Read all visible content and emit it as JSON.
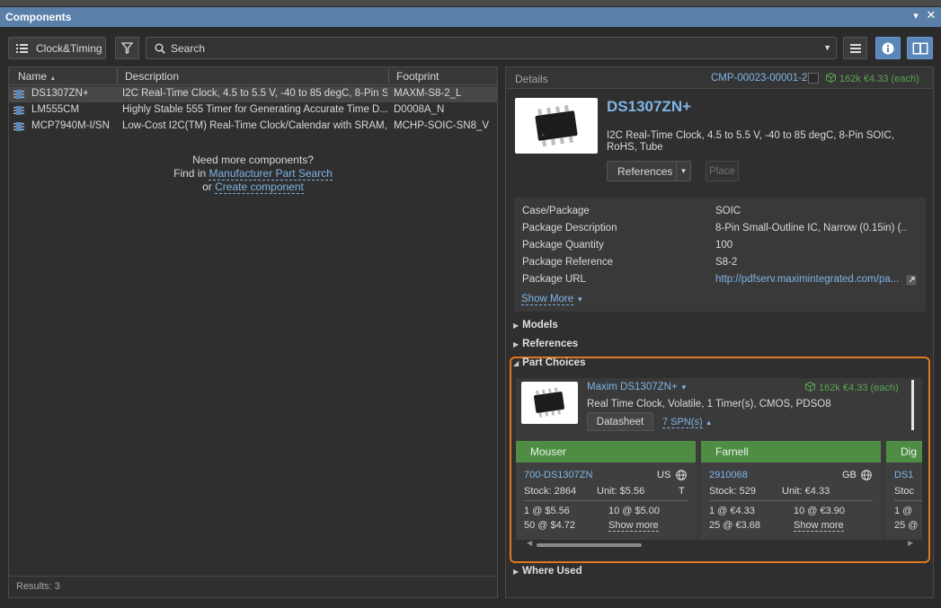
{
  "window": {
    "title": "Components",
    "menu_glyph": "▾",
    "close_glyph": "✕"
  },
  "toolbar": {
    "category_label": "Clock&Timing",
    "search_placeholder": "Search"
  },
  "table": {
    "columns": [
      "Name",
      "Description",
      "Footprint"
    ],
    "rows": [
      {
        "name": "DS1307ZN+",
        "description": "I2C Real-Time Clock, 4.5 to 5.5 V, -40 to 85 degC, 8-Pin S...",
        "footprint": "MAXM-S8-2_L"
      },
      {
        "name": "LM555CM",
        "description": "Highly Stable 555 Timer for Generating Accurate Time D...",
        "footprint": "D0008A_N"
      },
      {
        "name": "MCP7940M-I/SN",
        "description": "Low-Cost I2C(TM) Real-Time Clock/Calendar with SRAM,...",
        "footprint": "MCHP-SOIC-SN8_V"
      }
    ],
    "selected_index": 0,
    "sort_indicator": "▲"
  },
  "empty_message": {
    "line1": "Need more components?",
    "line2_prefix": "Find in",
    "mps_link": "Manufacturer Part Search",
    "line3_prefix": "or",
    "create_link": "Create component"
  },
  "results": "Results: 3",
  "details": {
    "header": "Details",
    "component_id": "CMP-00023-00001-2",
    "stock_summary": "162k  €4.33 (each)",
    "name": "DS1307ZN+",
    "description": "I2C Real-Time Clock, 4.5 to 5.5 V, -40 to 85 degC, 8-Pin SOIC, RoHS, Tube",
    "references_button": "References",
    "place_button": "Place",
    "properties": [
      {
        "key": "Case/Package",
        "value": "SOIC"
      },
      {
        "key": "Package Description",
        "value": "8-Pin Small-Outline IC, Narrow (0.15in) (..."
      },
      {
        "key": "Package Quantity",
        "value": "100"
      },
      {
        "key": "Package Reference",
        "value": "S8-2"
      },
      {
        "key": "Package URL",
        "value": "http://pdfserv.maximintegrated.com/pa..."
      }
    ],
    "show_more": "Show More",
    "sections": {
      "models": "Models",
      "references": "References",
      "part_choices": "Part Choices",
      "where_used": "Where Used"
    },
    "part_choice": {
      "manufacturer": "Maxim DS1307ZN+",
      "stock": "162k  €4.33 (each)",
      "description": "Real Time Clock, Volatile, 1 Timer(s), CMOS, PDSO8",
      "datasheet_button": "Datasheet",
      "spn": "7 SPN(s)",
      "suppliers": [
        {
          "name": "Mouser",
          "part": "700-DS1307ZN",
          "region": "US",
          "stock": "Stock: 2864",
          "unit": "Unit: $5.56",
          "flag": "T",
          "price_breaks": [
            "1 @ $5.56",
            "10 @ $5.00",
            "50 @ $4.72"
          ],
          "show_more": "Show more"
        },
        {
          "name": "Farnell",
          "part": "2910068",
          "region": "GB",
          "stock": "Stock: 529",
          "unit": "Unit: €4.33",
          "flag": "",
          "price_breaks": [
            "1 @ €4.33",
            "10 @ €3.90",
            "25 @ €3.68"
          ],
          "show_more": "Show more"
        },
        {
          "name": "Dig",
          "part": "DS1",
          "region": "",
          "stock": "Stoc",
          "unit": "",
          "flag": "",
          "price_breaks": [
            "1 @",
            "",
            "25 @"
          ],
          "show_more": ""
        }
      ]
    }
  },
  "colors": {
    "title_bar": "#5a7fa8",
    "link": "#7fb4e6",
    "stock_green": "#58a650",
    "supplier_header": "#4f8d45",
    "highlight_frame": "#e07820"
  }
}
